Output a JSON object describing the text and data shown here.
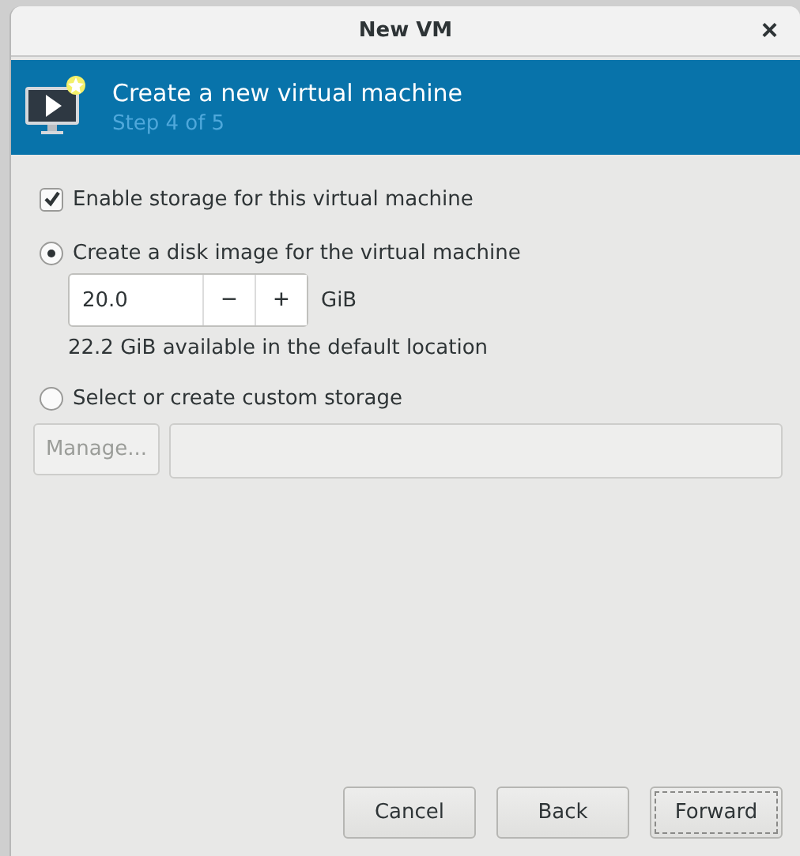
{
  "window": {
    "title": "New VM",
    "close": "×"
  },
  "header": {
    "title": "Create a new virtual machine",
    "step": "Step 4 of 5"
  },
  "storage": {
    "enable": {
      "label": "Enable storage for this virtual machine",
      "checked": true
    },
    "options": [
      {
        "kind": "disk",
        "label": "Create a disk image for the virtual machine",
        "selected": true,
        "size": "20.0",
        "minus": "−",
        "plus": "+",
        "unit": "GiB",
        "available": "22.2 GiB available in the default location"
      },
      {
        "kind": "custom",
        "label": "Select or create custom storage",
        "selected": false,
        "manage": {
          "label": "Manage...",
          "disabled": true
        },
        "path_field": {
          "disabled": true
        }
      }
    ]
  },
  "buttons": [
    {
      "label": "Cancel",
      "focused": false
    },
    {
      "label": "Back",
      "focused": false
    },
    {
      "label": "Forward",
      "focused": true
    }
  ]
}
